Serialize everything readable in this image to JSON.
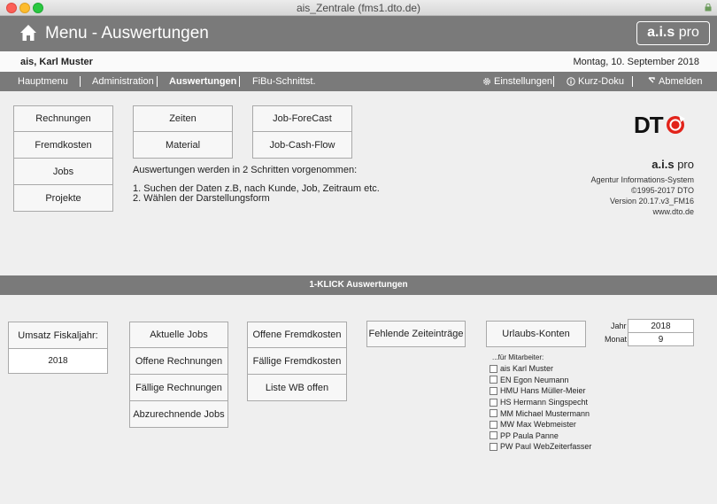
{
  "window": {
    "title": "ais_Zentrale (fms1.dto.de)"
  },
  "header": {
    "title": "Menu - Auswertungen",
    "logo_bold": "a.i.s",
    "logo_light": " pro"
  },
  "userbar": {
    "user": "ais, Karl Muster",
    "date": "Montag, 10. September 2018"
  },
  "nav": {
    "left": [
      "Hauptmenu",
      "Administration",
      "Auswertungen",
      "FiBu-Schnittst."
    ],
    "right": [
      "Einstellungen",
      "Kurz-Doku",
      "Abmelden"
    ]
  },
  "top": {
    "col1": [
      "Rechnungen",
      "Fremdkosten",
      "Jobs",
      "Projekte"
    ],
    "col2": [
      "Zeiten",
      "Material"
    ],
    "col3": [
      "Job-ForeCast",
      "Job-Cash-Flow"
    ],
    "info_line1": "Auswertungen werden in 2 Schritten vorgenommen:",
    "info_line2": "1. Suchen der Daten z.B, nach Kunde, Job, Zeitraum etc.",
    "info_line3": "2. Wählen der Darstellungsform"
  },
  "brand": {
    "logo_text": "DT",
    "name_bold": "a.i.s",
    "name_light": " pro",
    "line1": "Agentur Informations-System",
    "line2": "©1995-2017 DTO",
    "line3": "Version 20.17.v3_FM16",
    "line4": "www.dto.de"
  },
  "section_title": "1-KLICK Auswertungen",
  "bottom": {
    "umsatz_label": "Umsatz Fiskaljahr:",
    "umsatz_value": "2018",
    "group1": [
      "Aktuelle Jobs",
      "Offene Rechnungen",
      "Fällige Rechnungen",
      "Abzurechnende Jobs"
    ],
    "group2": [
      "Offene Fremdkosten",
      "Fällige Fremdkosten",
      "Liste WB offen"
    ],
    "fehlende": "Fehlende Zeiteinträge",
    "urlaub": "Urlaubs-Konten",
    "jahr_label": "Jahr",
    "jahr_value": "2018",
    "monat_label": "Monat",
    "monat_value": "9",
    "mitarbeiter_label": "...für Mitarbeiter:",
    "employees": [
      "ais Karl Muster",
      "EN Egon Neumann",
      "HMU Hans Müller-Meier",
      "HS Hermann Singspecht",
      "MM Michael Mustermann",
      "MW Max Webmeister",
      "PP Paula Panne",
      "PW Paul WebZeiterfasser"
    ]
  }
}
